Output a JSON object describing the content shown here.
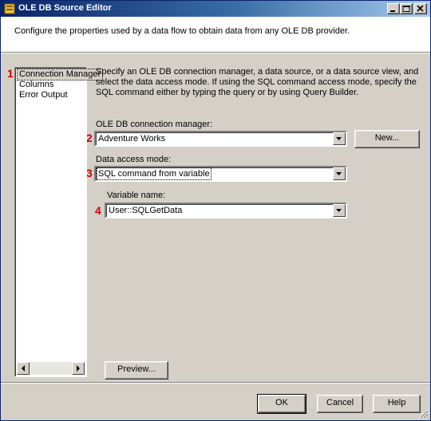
{
  "window": {
    "title": "OLE DB Source Editor",
    "header_text": "Configure the properties used by a data flow to obtain data from any OLE DB provider."
  },
  "nav": {
    "items": [
      {
        "label": "Connection Manager",
        "selected": true
      },
      {
        "label": "Columns",
        "selected": false
      },
      {
        "label": "Error Output",
        "selected": false
      }
    ]
  },
  "markers": [
    "1",
    "2",
    "3",
    "4"
  ],
  "content": {
    "description": "Specify an OLE DB connection manager, a data source, or a data source view, and select the data access mode. If using the SQL command access mode, specify the SQL command either by typing the query or by using Query Builder.",
    "connection_manager": {
      "label": "OLE DB connection manager:",
      "value": "Adventure Works",
      "new_button": "New..."
    },
    "access_mode": {
      "label": "Data access mode:",
      "value": "SQL command from variable"
    },
    "variable": {
      "label": "Variable name:",
      "value": "User::SQLGetData"
    },
    "preview_button": "Preview..."
  },
  "footer": {
    "ok": "OK",
    "cancel": "Cancel",
    "help": "Help"
  }
}
